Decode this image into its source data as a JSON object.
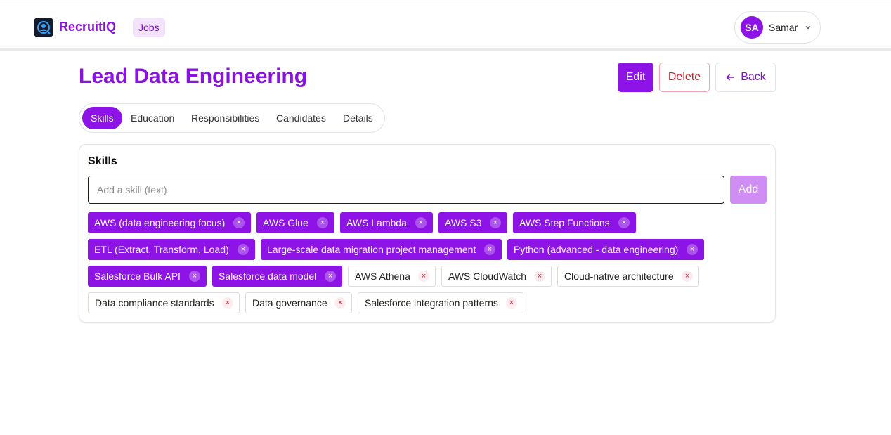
{
  "header": {
    "brand": "RecruitIQ",
    "nav_jobs": "Jobs",
    "user_initials": "SA",
    "user_name": "Samar"
  },
  "page": {
    "title": "Lead Data Engineering",
    "edit_label": "Edit",
    "delete_label": "Delete",
    "back_label": "Back"
  },
  "tabs": [
    {
      "label": "Skills",
      "active": true
    },
    {
      "label": "Education",
      "active": false
    },
    {
      "label": "Responsibilities",
      "active": false
    },
    {
      "label": "Candidates",
      "active": false
    },
    {
      "label": "Details",
      "active": false
    }
  ],
  "skills_card": {
    "title": "Skills",
    "input_placeholder": "Add a skill (text)",
    "add_label": "Add",
    "remove_glyph": "×"
  },
  "skills": [
    {
      "label": "AWS (data engineering focus)",
      "style": "filled"
    },
    {
      "label": "AWS Glue",
      "style": "filled"
    },
    {
      "label": "AWS Lambda",
      "style": "filled"
    },
    {
      "label": "AWS S3",
      "style": "filled"
    },
    {
      "label": "AWS Step Functions",
      "style": "filled"
    },
    {
      "label": "ETL (Extract, Transform, Load)",
      "style": "filled"
    },
    {
      "label": "Large-scale data migration project management",
      "style": "filled"
    },
    {
      "label": "Python (advanced - data engineering)",
      "style": "filled"
    },
    {
      "label": "Salesforce Bulk API",
      "style": "filled"
    },
    {
      "label": "Salesforce data model",
      "style": "filled"
    },
    {
      "label": "AWS Athena",
      "style": "outline"
    },
    {
      "label": "AWS CloudWatch",
      "style": "outline"
    },
    {
      "label": "Cloud-native architecture",
      "style": "outline"
    },
    {
      "label": "Data compliance standards",
      "style": "outline"
    },
    {
      "label": "Data governance",
      "style": "outline"
    },
    {
      "label": "Salesforce integration patterns",
      "style": "outline"
    }
  ],
  "colors": {
    "accent": "#8d13e6",
    "accent_light": "#d08ef5",
    "danger": "#d21c2c"
  }
}
